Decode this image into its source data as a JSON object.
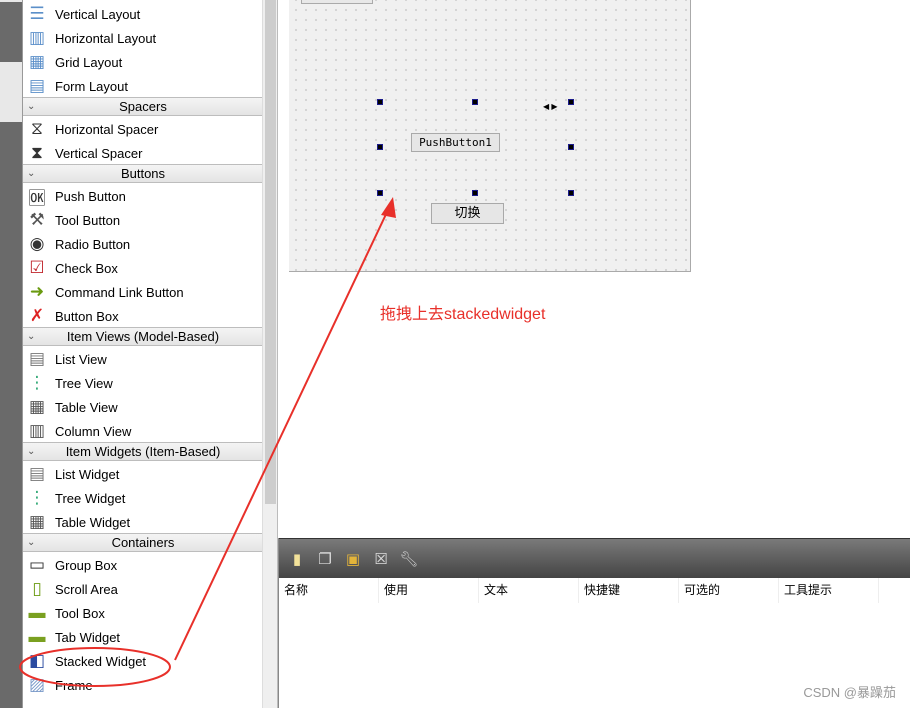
{
  "widget_box": {
    "groups": [
      {
        "header": null,
        "items": [
          {
            "label": "Vertical Layout",
            "icon": "vertical-layout-icon"
          },
          {
            "label": "Horizontal Layout",
            "icon": "horizontal-layout-icon"
          },
          {
            "label": "Grid Layout",
            "icon": "grid-layout-icon"
          },
          {
            "label": "Form Layout",
            "icon": "form-layout-icon"
          }
        ]
      },
      {
        "header": "Spacers",
        "items": [
          {
            "label": "Horizontal Spacer",
            "icon": "horizontal-spacer-icon"
          },
          {
            "label": "Vertical Spacer",
            "icon": "vertical-spacer-icon"
          }
        ]
      },
      {
        "header": "Buttons",
        "items": [
          {
            "label": "Push Button",
            "icon": "push-button-icon"
          },
          {
            "label": "Tool Button",
            "icon": "tool-button-icon"
          },
          {
            "label": "Radio Button",
            "icon": "radio-button-icon"
          },
          {
            "label": "Check Box",
            "icon": "check-box-icon"
          },
          {
            "label": "Command Link Button",
            "icon": "command-link-icon"
          },
          {
            "label": "Button Box",
            "icon": "button-box-icon"
          }
        ]
      },
      {
        "header": "Item Views (Model-Based)",
        "items": [
          {
            "label": "List View",
            "icon": "list-view-icon"
          },
          {
            "label": "Tree View",
            "icon": "tree-view-icon"
          },
          {
            "label": "Table View",
            "icon": "table-view-icon"
          },
          {
            "label": "Column View",
            "icon": "column-view-icon"
          }
        ]
      },
      {
        "header": "Item Widgets (Item-Based)",
        "items": [
          {
            "label": "List Widget",
            "icon": "list-widget-icon"
          },
          {
            "label": "Tree Widget",
            "icon": "tree-widget-icon"
          },
          {
            "label": "Table Widget",
            "icon": "table-widget-icon"
          }
        ]
      },
      {
        "header": "Containers",
        "items": [
          {
            "label": "Group Box",
            "icon": "group-box-icon"
          },
          {
            "label": "Scroll Area",
            "icon": "scroll-area-icon"
          },
          {
            "label": "Tool Box",
            "icon": "tool-box-icon"
          },
          {
            "label": "Tab Widget",
            "icon": "tab-widget-icon"
          },
          {
            "label": "Stacked Widget",
            "icon": "stacked-widget-icon"
          },
          {
            "label": "Frame",
            "icon": "frame-icon"
          }
        ]
      }
    ]
  },
  "form": {
    "push_button_1": "PushButton1",
    "switch_button": "切换"
  },
  "action_editor": {
    "columns": [
      "名称",
      "使用",
      "文本",
      "快捷键",
      "可选的",
      "工具提示"
    ]
  },
  "annotation": {
    "text": "拖拽上去stackedwidget",
    "color": "#e8302a"
  },
  "watermark": "CSDN @暴躁茄"
}
